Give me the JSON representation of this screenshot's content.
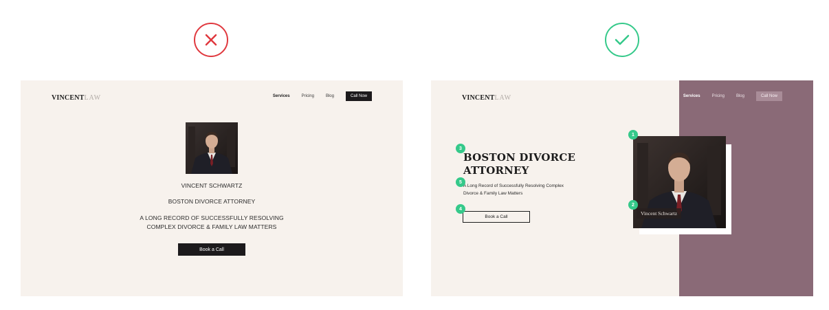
{
  "colors": {
    "bad": "#e0383e",
    "good": "#35c98a",
    "panel_background": "#f7f2ed",
    "accent_mauve": "#8a6a77",
    "dark_button": "#1c1a1c"
  },
  "icons": {
    "bad": "x-circle-icon",
    "good": "check-circle-icon"
  },
  "bad_example": {
    "logo_bold": "VINCENT",
    "logo_light": "LAW",
    "nav": [
      "Services",
      "Pricing",
      "Blog"
    ],
    "cta": "Call Now",
    "name": "VINCENT SCHWARTZ",
    "title": "BOSTON DIVORCE ATTORNEY",
    "tagline_line1": "A LONG RECORD OF SUCCESSFULLY RESOLVING",
    "tagline_line2": "COMPLEX DIVORCE & FAMILY LAW MATTERS",
    "button": "Book a Call"
  },
  "good_example": {
    "logo_bold": "VINCENT",
    "logo_light": "LAW",
    "nav": [
      "Services",
      "Pricing",
      "Blog"
    ],
    "cta": "Call Now",
    "headline_line1": "BOSTON DIVORCE",
    "headline_line2": "ATTORNEY",
    "tagline_line1": "A Long Record of Successfully Resolving Complex",
    "tagline_line2": "Divorce & Family Law Matters",
    "button": "Book a Call",
    "caption": "Vincent Schwartz",
    "badges": [
      "1",
      "2",
      "3",
      "4",
      "5"
    ]
  }
}
